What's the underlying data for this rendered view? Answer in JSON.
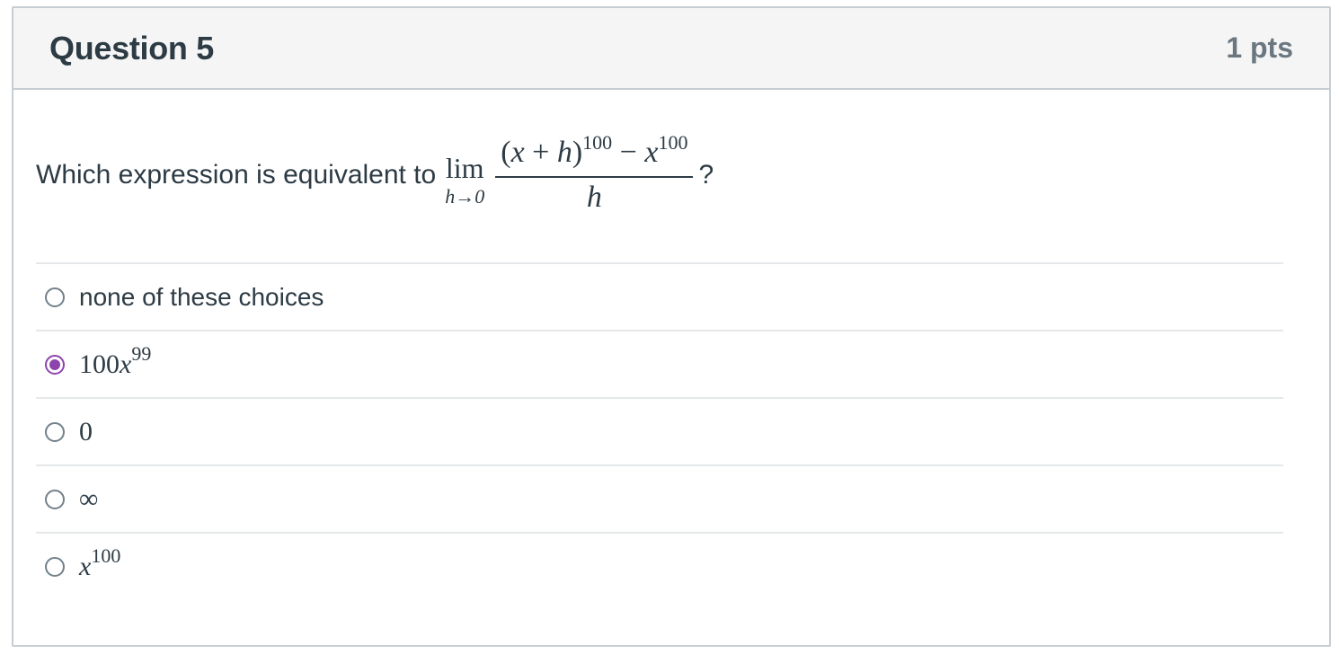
{
  "question": {
    "title": "Question 5",
    "points": "1 pts",
    "prompt_prefix": "Which expression is equivalent to",
    "limit": {
      "operator": "lim",
      "subscript": "h→0",
      "numerator_base_open": "(",
      "numerator_x": "x",
      "numerator_plus": " + ",
      "numerator_h": "h",
      "numerator_base_close": ")",
      "numerator_exp1": "100",
      "numerator_minus": " − ",
      "numerator_x2": "x",
      "numerator_exp2": "100",
      "denominator": "h"
    },
    "prompt_suffix": "?"
  },
  "answers": [
    {
      "text": "none of these choices",
      "selected": false
    },
    {
      "coef": "100",
      "var": "x",
      "exp": "99",
      "selected": true
    },
    {
      "text": "0",
      "selected": false
    },
    {
      "text": "∞",
      "selected": false
    },
    {
      "var": "x",
      "exp": "100",
      "selected": false
    }
  ],
  "colors": {
    "accent": "#8e44ad",
    "border": "#c7cdd1",
    "header_bg": "#f5f5f5",
    "text": "#2d3b45"
  }
}
